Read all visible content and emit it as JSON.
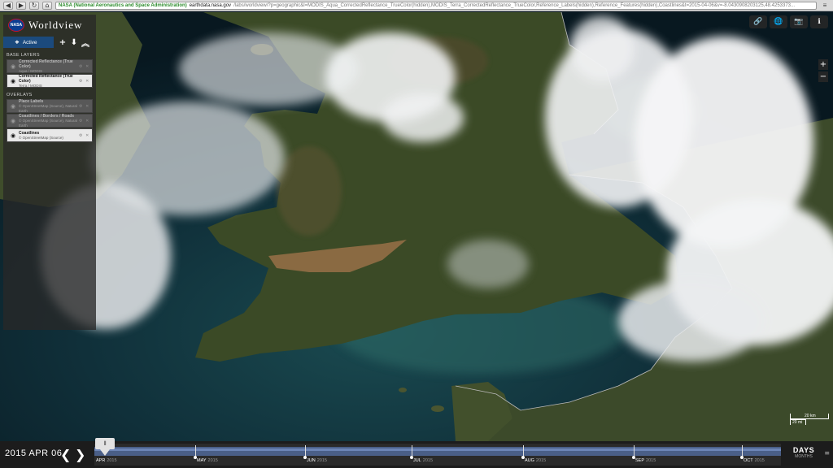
{
  "browser": {
    "back": "◀",
    "forward": "▶",
    "reload": "↻",
    "home": "⌂",
    "ssl_org": "NASA (National Aeronautics and Space Administration)",
    "url_host": "earthdata.nasa.gov",
    "url_path": "/labs/worldview/?p=geographic&l=MODIS_Aqua_CorrectedReflectance_TrueColor(hidden),MODIS_Terra_CorrectedReflectance_TrueColor,Reference_Labels(hidden),Reference_Features(hidden),Coastlines&t=2015-04-06&v=-8.0430908203125,48.4253373... ",
    "menu_icon": "≡"
  },
  "sidebar": {
    "logo_text": "NASA",
    "app_title": "Worldview",
    "active_tab": "Active",
    "add_icon": "+",
    "download_icon": "⬇",
    "collapse_icon": "︽",
    "base_layers_title": "BASE LAYERS",
    "base_layers": [
      {
        "name": "Corrected Reflectance (True Color)",
        "source": "Aqua / MODIS",
        "visible": false
      },
      {
        "name": "Corrected Reflectance (True Color)",
        "source": "Terra / MODIS",
        "visible": true
      }
    ],
    "overlays_title": "OVERLAYS",
    "overlays": [
      {
        "name": "Place Labels",
        "source": "© OpenStreetMap (Source), Natural Earth",
        "visible": false
      },
      {
        "name": "Coastlines / Borders / Roads",
        "source": "© OpenStreetMap (Source), Natural Earth",
        "visible": false
      },
      {
        "name": "Coastlines",
        "source": "© OpenStreetMap (Source)",
        "visible": true
      }
    ],
    "eye_icon": "◉",
    "layer_controls": "⚙ ✕"
  },
  "tools": {
    "link_icon": "🔗",
    "projection_icon": "🌐",
    "camera_icon": "📷",
    "info_icon": "ℹ",
    "zoom_in": "+",
    "zoom_out": "−"
  },
  "scale": {
    "km": "20 km",
    "mi": "20 mi"
  },
  "timeline": {
    "date": "2015 APR 06",
    "prev": "❮",
    "next": "❯",
    "handle_icon": "⦀",
    "year": "2015",
    "months": [
      "APR",
      "MAY",
      "JUN",
      "JUL",
      "AUG",
      "SEP",
      "OCT"
    ],
    "zoom_level": "DAYS",
    "zoom_sub": "MONTHS",
    "menu_icon": "≡"
  },
  "colors": {
    "ocean": "#0d2330",
    "land": "#3d4a2a",
    "cloud": "#eef0f2",
    "accent": "#1b4a7d"
  }
}
